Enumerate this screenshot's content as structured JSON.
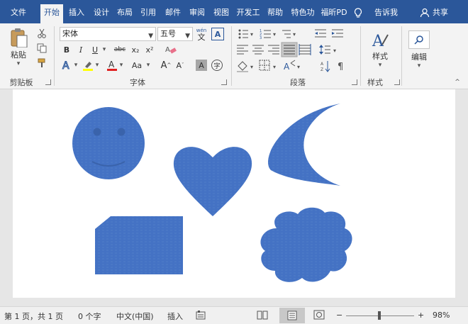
{
  "tabs": [
    {
      "label": "文件",
      "active": false
    },
    {
      "label": "开始",
      "active": true
    },
    {
      "label": "插入",
      "active": false
    },
    {
      "label": "设计",
      "active": false
    },
    {
      "label": "布局",
      "active": false
    },
    {
      "label": "引用",
      "active": false
    },
    {
      "label": "邮件",
      "active": false
    },
    {
      "label": "审阅",
      "active": false
    },
    {
      "label": "视图",
      "active": false
    },
    {
      "label": "开发工",
      "active": false
    },
    {
      "label": "帮助",
      "active": false
    },
    {
      "label": "特色功",
      "active": false
    },
    {
      "label": "福昕PD",
      "active": false
    }
  ],
  "tell_me": "告诉我",
  "share": "共享",
  "ribbon": {
    "clipboard": {
      "label": "剪贴板",
      "paste": "粘贴"
    },
    "font": {
      "label": "字体",
      "font_name": "宋体",
      "font_size": "五号",
      "wen": "wén",
      "wen_char": "文",
      "bold": "B",
      "italic": "I",
      "underline": "U",
      "strike": "abc",
      "sub": "x₂",
      "sup": "x²",
      "a_upper": "A",
      "aa": "Aa",
      "grow": "A",
      "shrink": "A",
      "char_shade": "A",
      "enclose": "字"
    },
    "paragraph": {
      "label": "段落"
    },
    "styles": {
      "label": "样式",
      "button": "样式"
    },
    "editing": {
      "button": "编辑"
    }
  },
  "status": {
    "page": "第 1 页，共 1 页",
    "words": "0 个字",
    "lang": "中文(中国)",
    "mode": "插入",
    "zoom_minus": "−",
    "zoom_plus": "+",
    "zoom": "98%"
  },
  "colors": {
    "accent": "#2b579a",
    "shape_fill": "#4472c4",
    "shape_dark": "#3a63ab"
  }
}
